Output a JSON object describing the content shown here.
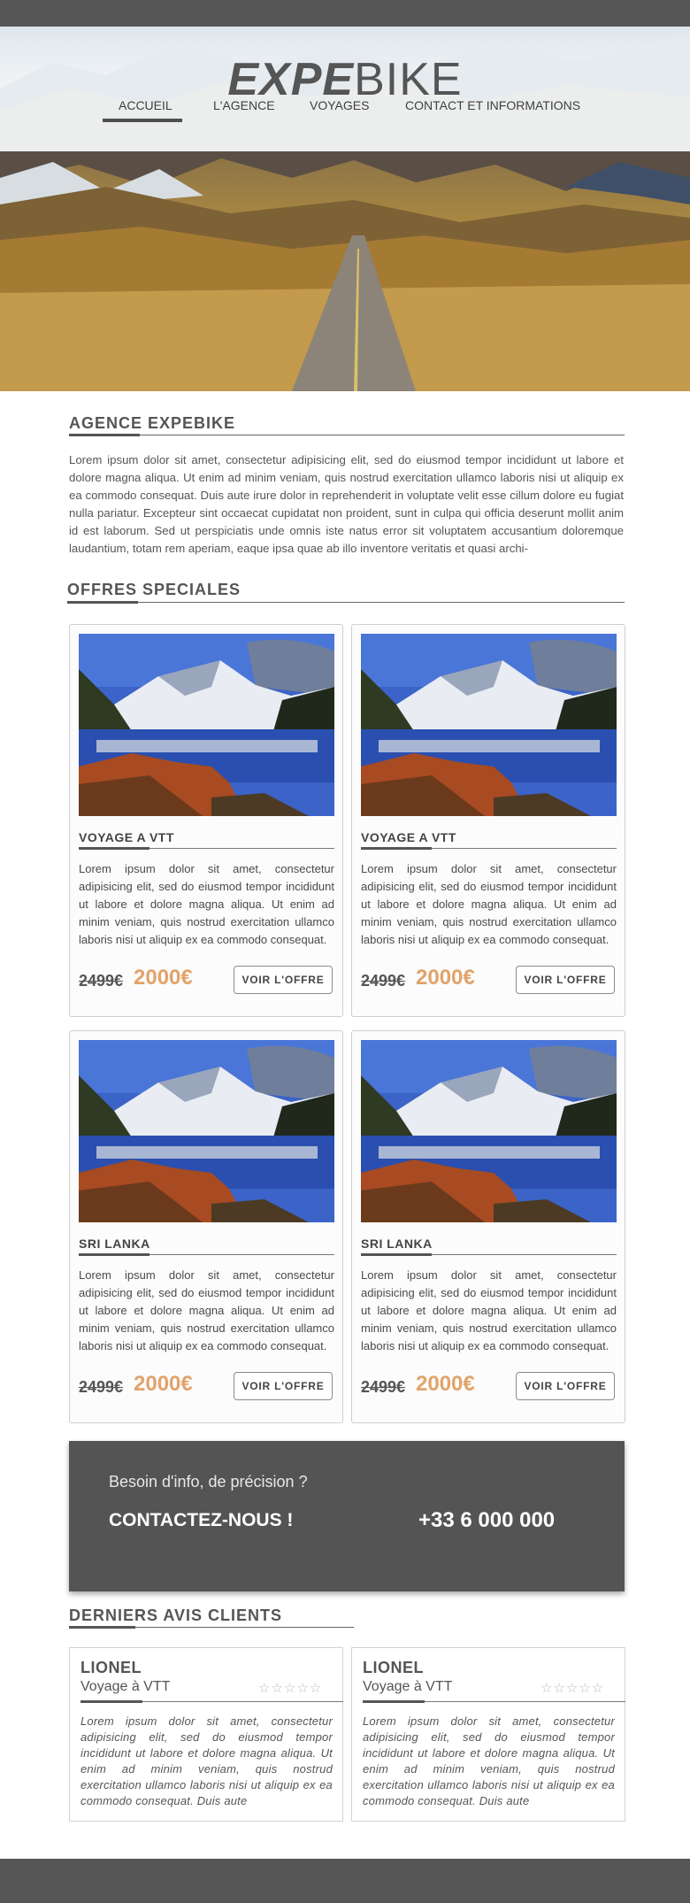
{
  "header": {
    "logo_bold": "EXPE",
    "logo_thin": "BIKE",
    "nav": [
      {
        "label": "ACCUEIL",
        "active": true
      },
      {
        "label": "L'AGENCE"
      },
      {
        "label": "VOYAGES"
      },
      {
        "label": "CONTACT ET INFORMATIONS"
      }
    ]
  },
  "agency": {
    "title": "AGENCE EXPEBIKE",
    "text": "Lorem ipsum dolor sit amet, consectetur adipisicing elit, sed do eiusmod tempor incididunt ut labore et dolore magna aliqua. Ut enim ad minim veniam, quis nostrud exercitation ullamco laboris nisi ut aliquip ex ea commodo consequat. Duis aute irure dolor in reprehenderit in voluptate velit esse cillum dolore eu fugiat nulla pariatur. Excepteur sint occaecat cupidatat non proident, sunt in culpa qui officia deserunt mollit anim id est laborum. Sed ut perspiciatis unde omnis iste natus error sit voluptatem accusantium doloremque laudantium, totam rem aperiam, eaque ipsa quae ab illo inventore veritatis et quasi archi-"
  },
  "offers": {
    "title": "OFFRES SPECIALES",
    "items": [
      {
        "title": "VOYAGE A VTT",
        "text": "Lorem ipsum dolor sit amet, consectetur adipisicing elit, sed do eiusmod tempor incididunt ut labore et dolore magna aliqua. Ut enim ad minim veniam, quis nostrud exercitation ullamco laboris nisi ut aliquip ex ea commodo consequat.",
        "old_price": "2499€",
        "new_price": "2000€",
        "button": "VOIR L'OFFRE"
      },
      {
        "title": "VOYAGE A VTT",
        "text": "Lorem ipsum dolor sit amet, consectetur adipisicing elit, sed do eiusmod tempor incididunt ut labore et dolore magna aliqua. Ut enim ad minim veniam, quis nostrud exercitation ullamco laboris nisi ut aliquip ex ea commodo consequat.",
        "old_price": "2499€",
        "new_price": "2000€",
        "button": "VOIR L'OFFRE"
      },
      {
        "title": "SRI LANKA",
        "text": "Lorem ipsum dolor sit amet, consectetur adipisicing elit, sed do eiusmod tempor incididunt ut labore et dolore magna aliqua. Ut enim ad minim veniam, quis nostrud exercitation ullamco laboris nisi ut aliquip ex ea commodo consequat.",
        "old_price": "2499€",
        "new_price": "2000€",
        "button": "VOIR L'OFFRE"
      },
      {
        "title": "SRI LANKA",
        "text": "Lorem ipsum dolor sit amet, consectetur adipisicing elit, sed do eiusmod tempor incididunt ut labore et dolore magna aliqua. Ut enim ad minim veniam, quis nostrud exercitation ullamco laboris nisi ut aliquip ex ea commodo consequat.",
        "old_price": "2499€",
        "new_price": "2000€",
        "button": "VOIR L'OFFRE"
      }
    ]
  },
  "contact": {
    "question": "Besoin d'info, de précision ?",
    "cta": "CONTACTEZ-NOUS !",
    "phone": "+33 6 000 000"
  },
  "reviews": {
    "title": "DERNIERS AVIS CLIENTS",
    "items": [
      {
        "name": "LIONEL",
        "trip": "Voyage à VTT",
        "stars": "☆☆☆☆☆",
        "rating": 0,
        "text": "Lorem ipsum dolor sit amet, consectetur adipisicing elit, sed do eiusmod tempor incididunt ut labore et dolore magna aliqua. Ut enim ad minim veniam, quis nostrud exercitation ullamco laboris nisi ut aliquip ex ea commodo consequat. Duis aute"
      },
      {
        "name": "LIONEL",
        "trip": "Voyage à VTT",
        "stars": "☆☆☆☆☆",
        "rating": 0,
        "text": "Lorem ipsum dolor sit amet, consectetur adipisicing elit, sed do eiusmod tempor incididunt ut labore et dolore magna aliqua. Ut enim ad minim veniam, quis nostrud exercitation ullamco laboris nisi ut aliquip ex ea commodo consequat. Duis aute"
      }
    ]
  },
  "colors": {
    "dark_bar": "#565656",
    "accent_price": "#e2a36a",
    "contact_bg": "#545454"
  }
}
